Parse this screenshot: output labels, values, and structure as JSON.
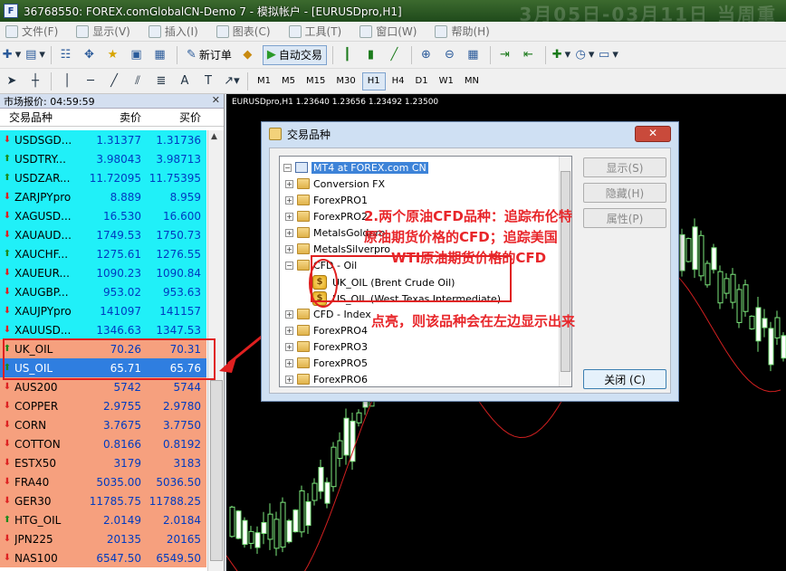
{
  "window": {
    "title": "36768550: FOREX.comGlobalCN-Demo 7 - 模拟帐户 - [EURUSDpro,H1]",
    "bg_text": "3月05日-03月11日 当周重"
  },
  "menu": [
    "文件(F)",
    "显示(V)",
    "插入(I)",
    "图表(C)",
    "工具(T)",
    "窗口(W)",
    "帮助(H)"
  ],
  "toolbar": {
    "new_order": "新订单",
    "auto_trade": "自动交易"
  },
  "timeframes": [
    "M1",
    "M5",
    "M15",
    "M30",
    "H1",
    "H4",
    "D1",
    "W1",
    "MN"
  ],
  "active_timeframe": "H1",
  "market_watch": {
    "header": "市场报价: 04:59:59",
    "col_symbol": "交易品种",
    "col_bid": "卖价",
    "col_ask": "买价",
    "rows": [
      {
        "sym": "USDSGD...",
        "bid": "1.31377",
        "ask": "1.31736",
        "dir": "dn",
        "bg": "cyan"
      },
      {
        "sym": "USDTRY...",
        "bid": "3.98043",
        "ask": "3.98713",
        "dir": "up",
        "bg": "cyan"
      },
      {
        "sym": "USDZAR...",
        "bid": "11.72095",
        "ask": "11.75395",
        "dir": "up",
        "bg": "cyan"
      },
      {
        "sym": "ZARJPYpro",
        "bid": "8.889",
        "ask": "8.959",
        "dir": "dn",
        "bg": "cyan"
      },
      {
        "sym": "XAGUSD...",
        "bid": "16.530",
        "ask": "16.600",
        "dir": "dn",
        "bg": "cyan"
      },
      {
        "sym": "XAUAUD...",
        "bid": "1749.53",
        "ask": "1750.73",
        "dir": "dn",
        "bg": "cyan"
      },
      {
        "sym": "XAUCHF...",
        "bid": "1275.61",
        "ask": "1276.55",
        "dir": "up",
        "bg": "cyan"
      },
      {
        "sym": "XAUEUR...",
        "bid": "1090.23",
        "ask": "1090.84",
        "dir": "dn",
        "bg": "cyan"
      },
      {
        "sym": "XAUGBP...",
        "bid": "953.02",
        "ask": "953.63",
        "dir": "dn",
        "bg": "cyan"
      },
      {
        "sym": "XAUJPYpro",
        "bid": "141097",
        "ask": "141157",
        "dir": "dn",
        "bg": "cyan"
      },
      {
        "sym": "XAUUSD...",
        "bid": "1346.63",
        "ask": "1347.53",
        "dir": "dn",
        "bg": "cyan"
      },
      {
        "sym": "UK_OIL",
        "bid": "70.26",
        "ask": "70.31",
        "dir": "up",
        "bg": "oil"
      },
      {
        "sym": "US_OIL",
        "bid": "65.71",
        "ask": "65.76",
        "dir": "up",
        "bg": "sel"
      },
      {
        "sym": "AUS200",
        "bid": "5742",
        "ask": "5744",
        "dir": "dn",
        "bg": "orange"
      },
      {
        "sym": "COPPER",
        "bid": "2.9755",
        "ask": "2.9780",
        "dir": "dn",
        "bg": "orange"
      },
      {
        "sym": "CORN",
        "bid": "3.7675",
        "ask": "3.7750",
        "dir": "dn",
        "bg": "orange"
      },
      {
        "sym": "COTTON",
        "bid": "0.8166",
        "ask": "0.8192",
        "dir": "dn",
        "bg": "orange"
      },
      {
        "sym": "ESTX50",
        "bid": "3179",
        "ask": "3183",
        "dir": "dn",
        "bg": "orange"
      },
      {
        "sym": "FRA40",
        "bid": "5035.00",
        "ask": "5036.50",
        "dir": "dn",
        "bg": "orange"
      },
      {
        "sym": "GER30",
        "bid": "11785.75",
        "ask": "11788.25",
        "dir": "dn",
        "bg": "orange"
      },
      {
        "sym": "HTG_OIL",
        "bid": "2.0149",
        "ask": "2.0184",
        "dir": "up",
        "bg": "orange"
      },
      {
        "sym": "JPN225",
        "bid": "20135",
        "ask": "20165",
        "dir": "dn",
        "bg": "orange"
      },
      {
        "sym": "NAS100",
        "bid": "6547.50",
        "ask": "6549.50",
        "dir": "dn",
        "bg": "orange"
      }
    ]
  },
  "chart": {
    "header": "EURUSDpro,H1  1.23640 1.23656 1.23492 1.23500"
  },
  "dialog": {
    "title": "交易品种",
    "tree": {
      "root": "MT4 at FOREX.com CN",
      "folders_top": [
        "Conversion FX",
        "ForexPRO1",
        "ForexPRO2",
        "MetalsGoldpro",
        "MetalsSilverpro"
      ],
      "cfd_oil": "CFD - Oil",
      "uk_oil": "UK_OIL  (Brent Crude Oil)",
      "us_oil": "US_OIL  (West Texas Intermediate)",
      "folders_bottom": [
        "CFD - Index",
        "ForexPRO4",
        "ForexPRO3",
        "ForexPRO5",
        "ForexPRO6"
      ]
    },
    "buttons": {
      "show": "显示(S)",
      "hide": "隐藏(H)",
      "props": "属性(P)",
      "close": "关闭 (C)"
    }
  },
  "annotations": {
    "line1": "2.两个原油CFD品种：追踪布伦特",
    "line2": "原油期货价格的CFD；追踪美国",
    "line3": "WTI原油期货价格的CFD",
    "line4": "点亮，则该品种会在左边显示出来"
  }
}
